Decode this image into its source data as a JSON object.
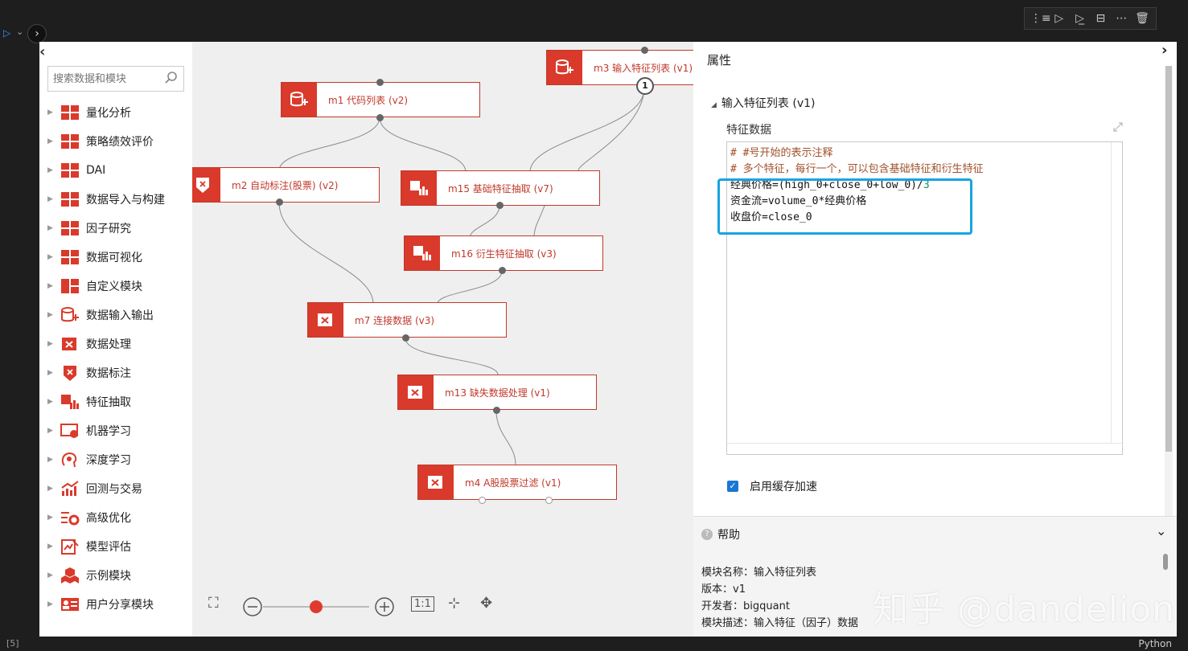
{
  "cell_toolbar": {
    "buttons": [
      "run-by-line-icon",
      "execute-above-icon",
      "execute-below-icon",
      "split-cell-icon",
      "more-icon",
      "delete-icon"
    ]
  },
  "colors": {
    "accent_red": "#d93a2b",
    "highlight_blue": "#18a4e0",
    "checkbox_blue": "#1976d2"
  },
  "sidebar": {
    "search_placeholder": "搜索数据和模块",
    "items": [
      {
        "label": "量化分析",
        "icon": "grid-icon"
      },
      {
        "label": "策略绩效评价",
        "icon": "grid-icon"
      },
      {
        "label": "DAI",
        "icon": "grid-icon"
      },
      {
        "label": "数据导入与构建",
        "icon": "grid-icon"
      },
      {
        "label": "因子研究",
        "icon": "grid-icon"
      },
      {
        "label": "数据可视化",
        "icon": "grid-icon"
      },
      {
        "label": "自定义模块",
        "icon": "grid-custom-icon"
      },
      {
        "label": "数据输入输出",
        "icon": "database-add-icon"
      },
      {
        "label": "数据处理",
        "icon": "data-process-icon"
      },
      {
        "label": "数据标注",
        "icon": "tag-icon"
      },
      {
        "label": "特征抽取",
        "icon": "feature-extract-icon"
      },
      {
        "label": "机器学习",
        "icon": "monitor-icon"
      },
      {
        "label": "深度学习",
        "icon": "brain-icon"
      },
      {
        "label": "回测与交易",
        "icon": "trend-chart-icon"
      },
      {
        "label": "高级优化",
        "icon": "settings-list-icon"
      },
      {
        "label": "模型评估",
        "icon": "edit-chart-icon"
      },
      {
        "label": "示例模块",
        "icon": "cubes-icon"
      },
      {
        "label": "用户分享模块",
        "icon": "user-card-icon"
      }
    ]
  },
  "canvas": {
    "nodes": [
      {
        "id": "m3",
        "label": "m3 输入特征列表 (v1)",
        "badge": "1"
      },
      {
        "id": "m1",
        "label": "m1 代码列表 (v2)"
      },
      {
        "id": "m2",
        "label": "m2 自动标注(股票) (v2)"
      },
      {
        "id": "m15",
        "label": "m15 基础特征抽取 (v7)"
      },
      {
        "id": "m16",
        "label": "m16 衍生特征抽取 (v3)"
      },
      {
        "id": "m7",
        "label": "m7 连接数据 (v3)"
      },
      {
        "id": "m13",
        "label": "m13 缺失数据处理 (v1)"
      },
      {
        "id": "m4",
        "label": "m4 A股股票过滤 (v1)"
      }
    ],
    "zoom": {
      "reset_label": "1:1",
      "level": 0.5
    }
  },
  "properties": {
    "title": "属性",
    "section": "输入特征列表 (v1)",
    "field_label": "特征数据",
    "editor_lines": [
      {
        "text": "# #号开始的表示注释",
        "kind": "comment"
      },
      {
        "text": "# 多个特征，每行一个，可以包含基础特征和衍生特征",
        "kind": "comment"
      },
      {
        "text": "经典价格=(high_0+close_0+low_0)/",
        "kind": "code",
        "tail": "3"
      },
      {
        "text": "资金流=volume_0*经典价格",
        "kind": "code"
      },
      {
        "text": "收盘价=close_0",
        "kind": "code"
      }
    ],
    "cache_label": "启用缓存加速",
    "cache_checked": true
  },
  "help": {
    "title": "帮助",
    "lines": [
      "模块名称：输入特征列表",
      "版本：v1",
      "开发者：bigquant",
      "模块描述：输入特征（因子）数据"
    ]
  },
  "watermark": "知乎 @dandelion",
  "status": {
    "exec_count": "[5]",
    "language": "Python"
  }
}
